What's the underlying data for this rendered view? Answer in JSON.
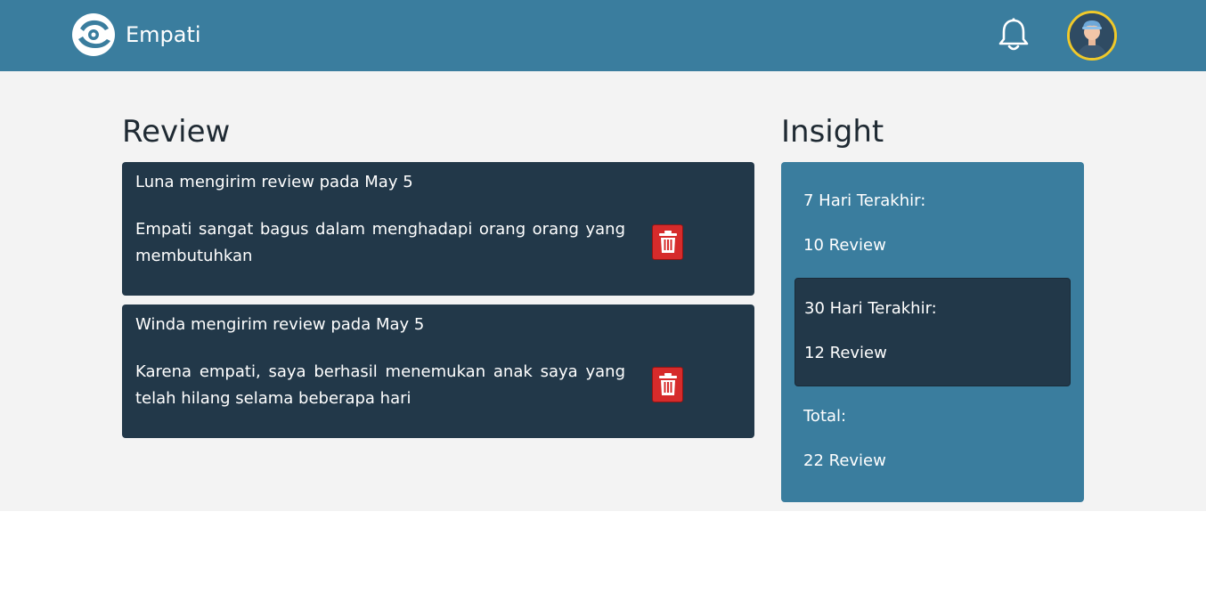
{
  "app": {
    "name": "Empati",
    "accent_color": "#3a7d9e",
    "dark_color": "#223849",
    "danger_color": "#d62b2b"
  },
  "header": {
    "notification_icon": "bell-icon",
    "avatar_icon": "user-avatar"
  },
  "review": {
    "title": "Review",
    "items": [
      {
        "header": "Luna mengirim review pada May 5",
        "text": "Empati sangat bagus dalam menghadapi orang orang yang membutuhkan",
        "delete_icon": "trash-icon"
      },
      {
        "header": "Winda mengirim review pada May 5",
        "text": "Karena empati, saya berhasil menemukan anak saya yang telah hilang selama beberapa hari",
        "delete_icon": "trash-icon"
      }
    ]
  },
  "insight": {
    "title": "Insight",
    "week_label": "7 Hari Terakhir:",
    "week_value": "10 Review",
    "month_label": "30 Hari Terakhir:",
    "month_value": "12 Review",
    "total_label": "Total:",
    "total_value": "22 Review"
  }
}
